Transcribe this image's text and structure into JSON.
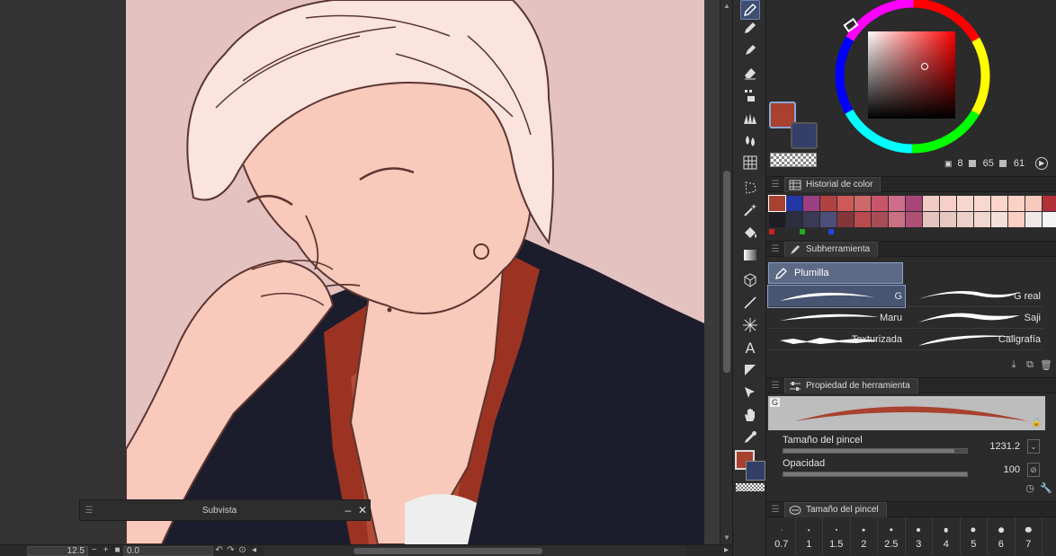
{
  "colors": {
    "main": "#a8412f",
    "sub": "#343f67",
    "skin": "#f9c9bb",
    "background": "#e3c2c0",
    "jacket": "#1c1d2c",
    "shirt": "#9c3322",
    "line": "#5c3530"
  },
  "color_panel": {
    "hsv": {
      "h": "8",
      "s": "65",
      "v": "61"
    }
  },
  "color_history": {
    "title": "Historial de color",
    "swatches": [
      "#a8412f",
      "#2337a5",
      "#9b3f82",
      "#b14244",
      "#cd5a55",
      "#cf6868",
      "#c9556a",
      "#cf6e8a",
      "#a8467a",
      "#f3cbc5",
      "#f6d0c8",
      "#f8d7ce",
      "#f9d9cf",
      "#fbd5c9",
      "#fcd1c6",
      "#f9c9bb",
      "#b23038",
      "#1e1e24",
      "#2c2d3f",
      "#3a3a55",
      "#4d4e7a",
      "#84363a",
      "#b74b4e",
      "#a84c58",
      "#c97184",
      "#b05074",
      "#e5c3c0",
      "#e6c8c0",
      "#ebd0c7",
      "#f0d8cf",
      "#f4e0d9",
      "#fbcfc4",
      "#efe8e6",
      "#f4f4f4"
    ],
    "dots": [
      "#cc2222",
      "#22aa22",
      "#2244dd"
    ]
  },
  "subtool": {
    "title": "Subherramienta",
    "group": "Plumilla",
    "brushes": [
      {
        "label": "G",
        "selected": true
      },
      {
        "label": "G real",
        "selected": false
      },
      {
        "label": "Maru",
        "selected": false
      },
      {
        "label": "Saji",
        "selected": false
      },
      {
        "label": "Texturizada",
        "selected": false
      },
      {
        "label": "Caligrafía",
        "selected": false
      }
    ]
  },
  "tool_property": {
    "title": "Propiedad de herramienta",
    "badge": "G",
    "size_label": "Tamaño del pincel",
    "size_value": "1231.2",
    "size_fraction": 0.93,
    "opacity_label": "Opacidad",
    "opacity_value": "100",
    "opacity_fraction": 1.0
  },
  "brush_size": {
    "title": "Tamaño del pincel",
    "sizes": [
      "0.7",
      "1",
      "1.5",
      "2",
      "2.5",
      "3",
      "4",
      "5",
      "6",
      "7"
    ]
  },
  "subvista": {
    "title": "Subvista"
  },
  "status": {
    "zoom": "12.5",
    "angle": "0.0"
  },
  "tools": [
    "pen-icon",
    "pencil-icon",
    "marker-icon",
    "eraser-icon",
    "decoration-icon",
    "grass-icon",
    "blend-icon",
    "grid-icon",
    "lasso-icon",
    "magic-wand-icon",
    "fill-icon",
    "gradient-icon",
    "3d-cube-icon",
    "line-icon",
    "ruler-icon",
    "text-icon",
    "frame-icon",
    "operation-icon",
    "hand-icon",
    "eyedropper-icon"
  ]
}
